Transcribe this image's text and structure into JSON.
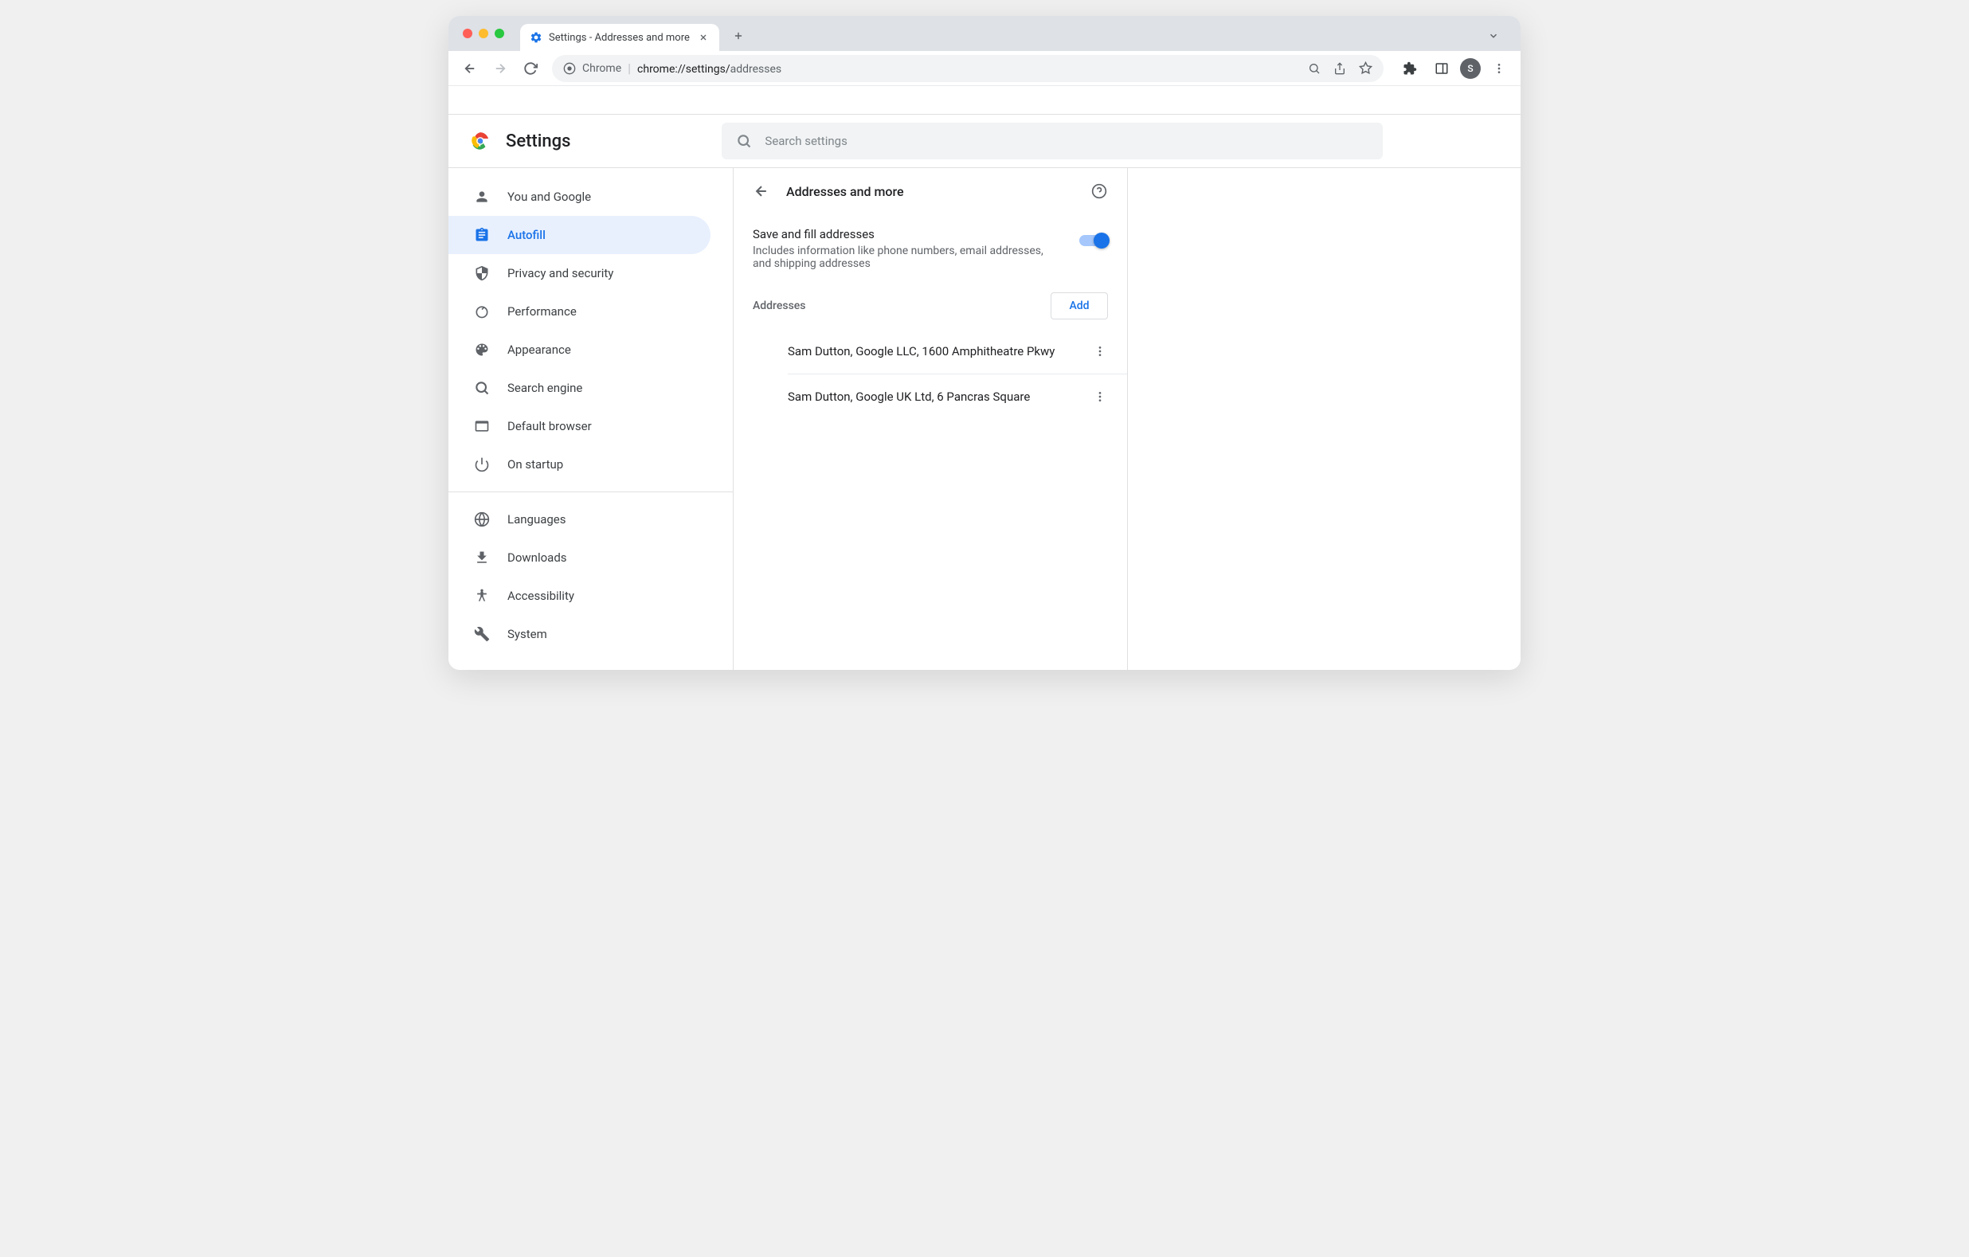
{
  "browser": {
    "tab_title": "Settings - Addresses and more",
    "omnibox_scheme": "Chrome",
    "omnibox_url_prefix": "chrome://",
    "omnibox_url_mid": "settings/",
    "omnibox_url_suffix": "addresses",
    "avatar_letter": "S"
  },
  "settings": {
    "app_title": "Settings",
    "search_placeholder": "Search settings"
  },
  "sidebar": {
    "items": [
      {
        "label": "You and Google"
      },
      {
        "label": "Autofill"
      },
      {
        "label": "Privacy and security"
      },
      {
        "label": "Performance"
      },
      {
        "label": "Appearance"
      },
      {
        "label": "Search engine"
      },
      {
        "label": "Default browser"
      },
      {
        "label": "On startup"
      },
      {
        "label": "Languages"
      },
      {
        "label": "Downloads"
      },
      {
        "label": "Accessibility"
      },
      {
        "label": "System"
      }
    ]
  },
  "panel": {
    "title": "Addresses and more",
    "save_fill": {
      "title": "Save and fill addresses",
      "desc": "Includes information like phone numbers, email addresses, and shipping addresses",
      "enabled": true
    },
    "addresses": {
      "section_title": "Addresses",
      "add_label": "Add",
      "items": [
        "Sam Dutton, Google LLC, 1600 Amphitheatre Pkwy",
        "Sam Dutton, Google UK Ltd, 6 Pancras Square"
      ]
    }
  }
}
